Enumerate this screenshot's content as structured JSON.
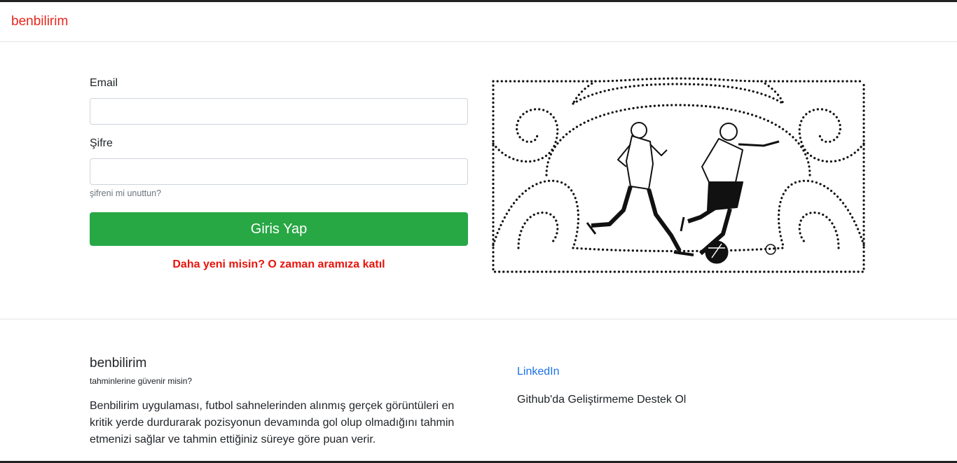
{
  "navbar": {
    "brand": "benbilirim"
  },
  "login": {
    "email_label": "Email",
    "email_value": "",
    "password_label": "Şifre",
    "password_value": "",
    "forgot_password": "şifreni mi unuttun?",
    "submit_label": "Giris Yap",
    "register_link": "Daha yeni misin? O zaman aramıza katıl"
  },
  "footer": {
    "title": "benbilirim",
    "tagline": "tahminlerine güvenir misin?",
    "description": "Benbilirim uygulaması, futbol sahnelerinden alınmış gerçek görüntüleri en kritik yerde durdurarak pozisyonun devamında gol olup olmadığını tahmin etmenizi sağlar ve tahmin ettiğiniz süreye göre puan verir.",
    "linkedin": "LinkedIn",
    "github": "Github'da Geliştirmeme Destek Ol"
  },
  "colors": {
    "brand": "#e8271d",
    "button": "#28a745",
    "register_link": "#e8140c",
    "link": "#1a73e8"
  },
  "icons": {
    "illustration": "football-players-illustration"
  }
}
